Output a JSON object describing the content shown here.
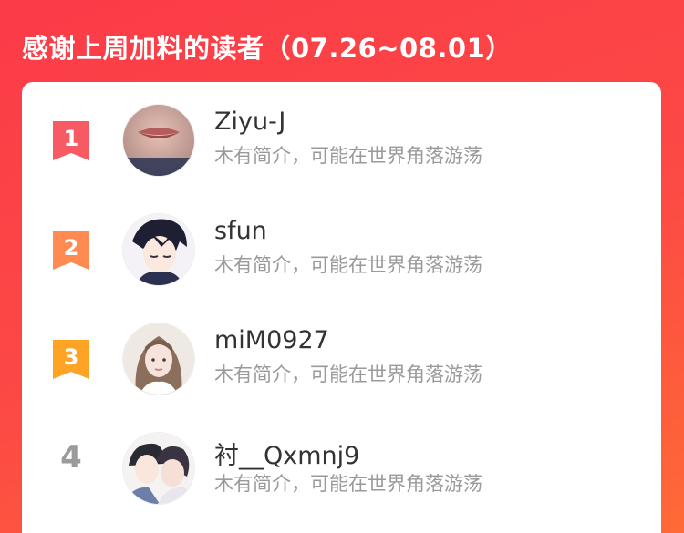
{
  "header": {
    "title": "感谢上周加料的读者（07.26~08.01）"
  },
  "colors": {
    "background_start": "#fb3b48",
    "background_end": "#ff6a36",
    "rank1": "#f75a62",
    "rank2": "#ff8a52",
    "rank3": "#ffa325",
    "rank_plain": "#9b9b9b"
  },
  "readers": [
    {
      "rank": "1",
      "name": "Ziyu-J",
      "description": "木有简介，可能在世界角落游荡",
      "avatar_icon": "avatar-photo-lips"
    },
    {
      "rank": "2",
      "name": "sfun",
      "description": "木有简介，可能在世界角落游荡",
      "avatar_icon": "avatar-anime-boy"
    },
    {
      "rank": "3",
      "name": "miM0927",
      "description": "木有简介，可能在世界角落游荡",
      "avatar_icon": "avatar-photo-girl"
    },
    {
      "rank": "4",
      "name": "衬__Qxmnj9",
      "description": "木有简介，可能在世界角落游荡",
      "avatar_icon": "avatar-anime-couple"
    }
  ]
}
